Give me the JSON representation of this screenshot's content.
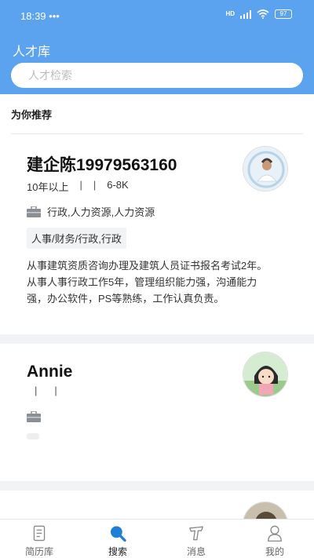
{
  "status_bar": {
    "time": "18:39 •••",
    "network": "HD",
    "battery": "97"
  },
  "header": {
    "title": "人才库"
  },
  "search": {
    "placeholder": "人才检索",
    "value": ""
  },
  "section": {
    "title": "为你推荐"
  },
  "cards": [
    {
      "name": "建企陈19979563160",
      "experience": "10年以上",
      "sep1": "|",
      "sep2": "|",
      "salary": "6-8K",
      "industry": "行政,人力资源,人力资源",
      "tag": "人事/财务/行政,行政",
      "description": "从事建筑资质咨询办理及建筑人员证书报名考试2年。从事人事行政工作5年，管理组织能力强，沟通能力强，办公软件，PS等熟练，工作认真负责。"
    },
    {
      "name": "Annie",
      "experience": "",
      "sep1": "|",
      "sep2": "|",
      "salary": "",
      "industry": "",
      "tag": "",
      "description": ""
    }
  ],
  "tabbar": {
    "items": [
      {
        "label": "简历库",
        "icon": "document-icon"
      },
      {
        "label": "搜索",
        "icon": "search-icon",
        "active": true
      },
      {
        "label": "消息",
        "icon": "message-icon"
      },
      {
        "label": "我的",
        "icon": "profile-icon"
      }
    ]
  },
  "colors": {
    "accent": "#5ba3ef",
    "active_icon": "#1f7fd6"
  }
}
